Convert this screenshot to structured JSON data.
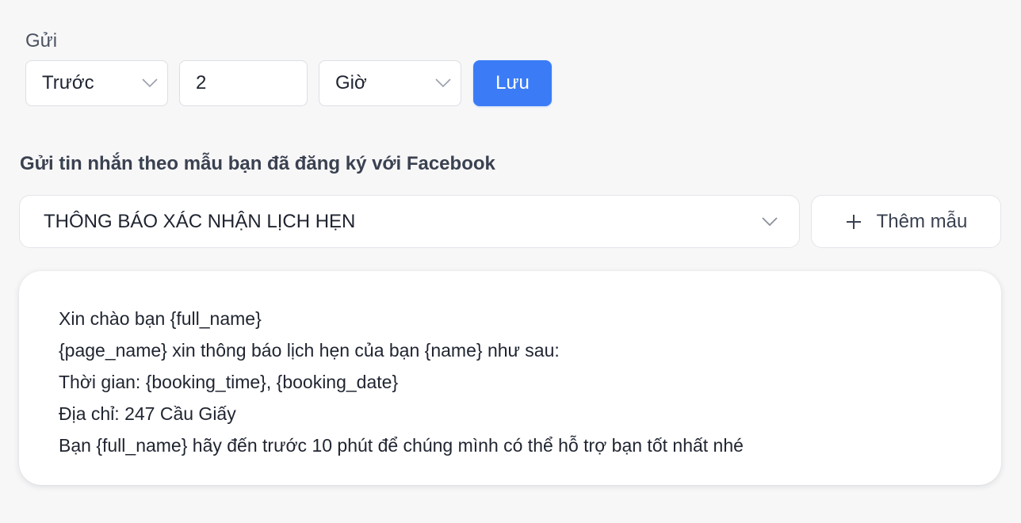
{
  "send": {
    "label": "Gửi",
    "timing_value": "Trước",
    "amount_value": "2",
    "unit_value": "Giờ",
    "save_label": "Lưu"
  },
  "template": {
    "section_title": "Gửi tin nhắn theo mẫu bạn đã đăng ký với Facebook",
    "selected": "THÔNG BÁO XÁC NHẬN LỊCH HẸN",
    "add_label": "Thêm mẫu"
  },
  "preview": {
    "lines": [
      "Xin chào bạn {full_name}",
      "{page_name} xin thông báo lịch hẹn của bạn {name} như sau:",
      "Thời gian: {booking_time}, {booking_date}",
      "Địa chỉ: 247 Cầu Giấy",
      "Bạn {full_name} hãy đến trước 10 phút để chúng mình có thể hỗ trợ bạn tốt nhất nhé"
    ]
  },
  "icons": {
    "chevron": "chevron-down-icon",
    "plus": "plus-icon"
  },
  "colors": {
    "primary": "#3b7cf6",
    "background": "#f7f7f8"
  }
}
